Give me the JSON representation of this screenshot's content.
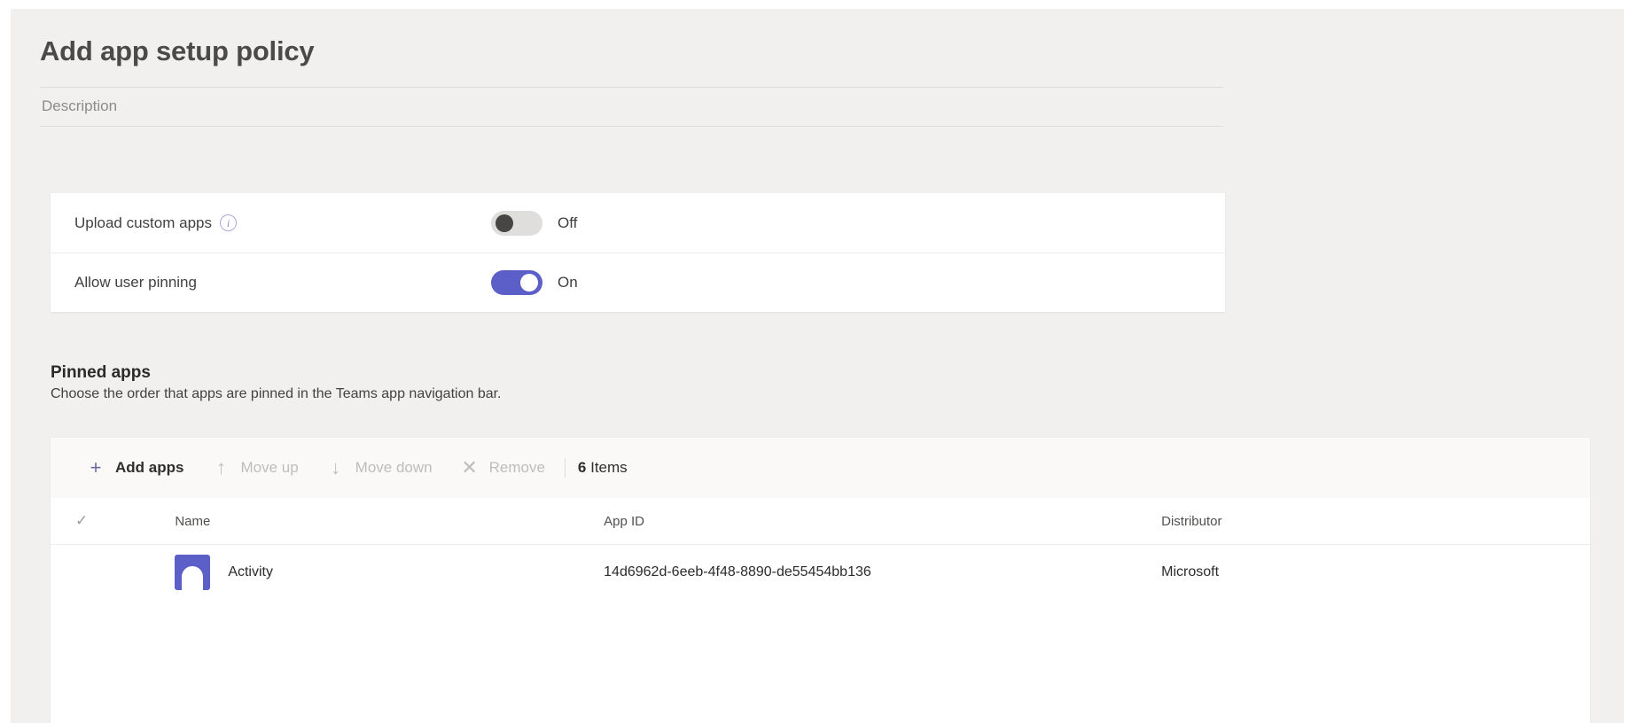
{
  "header": {
    "title": "Add app setup policy",
    "description_placeholder": "Description",
    "description_value": ""
  },
  "settings": {
    "rows": [
      {
        "label": "Upload custom apps",
        "info_icon": "info-circle-icon",
        "state": "Off",
        "enabled": false
      },
      {
        "label": "Allow user pinning",
        "info_icon": "",
        "state": "On",
        "enabled": true
      }
    ]
  },
  "pinned_apps": {
    "title": "Pinned apps",
    "subtitle": "Choose the order that apps are pinned in the Teams app navigation bar.",
    "toolbar": {
      "add_apps": {
        "label": "Add apps",
        "icon": "plus-icon",
        "disabled": false
      },
      "move_up": {
        "label": "Move up",
        "icon": "arrow-up-icon",
        "disabled": true
      },
      "move_down": {
        "label": "Move down",
        "icon": "arrow-down-icon",
        "disabled": true
      },
      "remove": {
        "label": "Remove",
        "icon": "close-x-icon",
        "disabled": true
      },
      "items_count": "6",
      "items_label": "Items"
    },
    "table": {
      "select_all_icon": "checkmark-icon",
      "columns": {
        "name": "Name",
        "app_id": "App ID",
        "distributor": "Distributor"
      },
      "rows": [
        {
          "name": "Activity",
          "app_id": "14d6962d-6eeb-4f48-8890-de55454bb136",
          "distributor": "Microsoft",
          "icon": "activity-app-icon",
          "icon_color": "#5b5fc7"
        }
      ]
    }
  },
  "colors": {
    "accent": "#5b5fc7",
    "page_background": "#f1f0ef",
    "card_background": "#ffffff",
    "toggle_off_track": "#dfdedd",
    "toggle_off_knob": "#484644"
  }
}
